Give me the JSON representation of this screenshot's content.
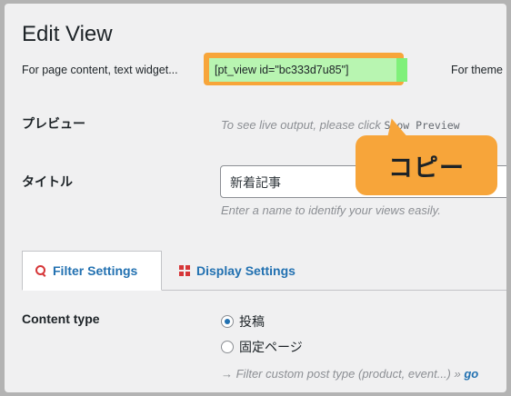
{
  "page": {
    "title": "Edit View"
  },
  "shortcode": {
    "lead_text": "For page content, text widget...",
    "code": "[pt_view id=\"bc333d7u85\"]",
    "theme_text": "For theme"
  },
  "preview": {
    "label": "プレビュー",
    "hint": "To see live output, please click",
    "show_preview": "Show Preview"
  },
  "title_field": {
    "label": "タイトル",
    "value": "新着記事",
    "hint": "Enter a name to identify your views easily."
  },
  "callout": {
    "text": "コピー"
  },
  "tabs": [
    {
      "label": "Filter Settings",
      "icon": "search-icon",
      "active": true
    },
    {
      "label": "Display Settings",
      "icon": "grid-icon",
      "active": false
    }
  ],
  "content_type": {
    "label": "Content type",
    "options": [
      {
        "label": "投稿",
        "selected": true
      },
      {
        "label": "固定ページ",
        "selected": false
      }
    ],
    "hint": "→ Filter custom post type (product, event...) »",
    "hint_link": "go"
  },
  "colors": {
    "accent": "#2271b1",
    "highlight_orange": "#f7a53a",
    "highlight_green": "#b8f5b1",
    "icon_red": "#d63638"
  }
}
